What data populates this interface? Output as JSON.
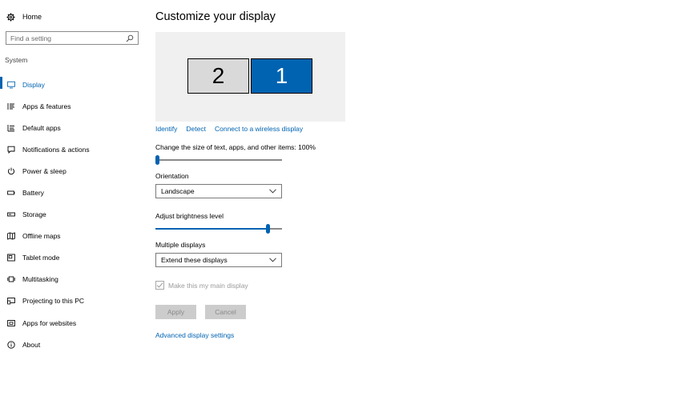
{
  "sidebar": {
    "home_label": "Home",
    "search_placeholder": "Find a setting",
    "section_label": "System",
    "items": [
      {
        "label": "Display",
        "icon": "monitor-icon",
        "active": true
      },
      {
        "label": "Apps & features",
        "icon": "apps-list-icon"
      },
      {
        "label": "Default apps",
        "icon": "default-apps-icon"
      },
      {
        "label": "Notifications & actions",
        "icon": "notification-icon"
      },
      {
        "label": "Power & sleep",
        "icon": "power-icon"
      },
      {
        "label": "Battery",
        "icon": "battery-icon"
      },
      {
        "label": "Storage",
        "icon": "storage-icon"
      },
      {
        "label": "Offline maps",
        "icon": "map-icon"
      },
      {
        "label": "Tablet mode",
        "icon": "tablet-icon"
      },
      {
        "label": "Multitasking",
        "icon": "multitasking-icon"
      },
      {
        "label": "Projecting to this PC",
        "icon": "projecting-icon"
      },
      {
        "label": "Apps for websites",
        "icon": "apps-websites-icon"
      },
      {
        "label": "About",
        "icon": "info-icon"
      }
    ]
  },
  "main": {
    "title": "Customize your display",
    "monitors": [
      {
        "number": "2",
        "selected": false
      },
      {
        "number": "1",
        "selected": true
      }
    ],
    "links": {
      "identify": "Identify",
      "detect": "Detect",
      "connect": "Connect to a wireless display"
    },
    "scale": {
      "label": "Change the size of text, apps, and other items: 100%",
      "value_fraction": 0.0
    },
    "orientation": {
      "label": "Orientation",
      "value": "Landscape"
    },
    "brightness": {
      "label": "Adjust brightness level",
      "value_fraction": 0.9
    },
    "multiple_displays": {
      "label": "Multiple displays",
      "value": "Extend these displays"
    },
    "main_display": {
      "label": "Make this my main display",
      "checked": true,
      "disabled": true
    },
    "buttons": {
      "apply": "Apply",
      "cancel": "Cancel"
    },
    "advanced_link": "Advanced display settings"
  },
  "colors": {
    "accent": "#0063b1",
    "preview_bg": "#f0f0f0",
    "monitor_inactive": "#d9d9d9",
    "button_disabled": "#cccccc"
  }
}
